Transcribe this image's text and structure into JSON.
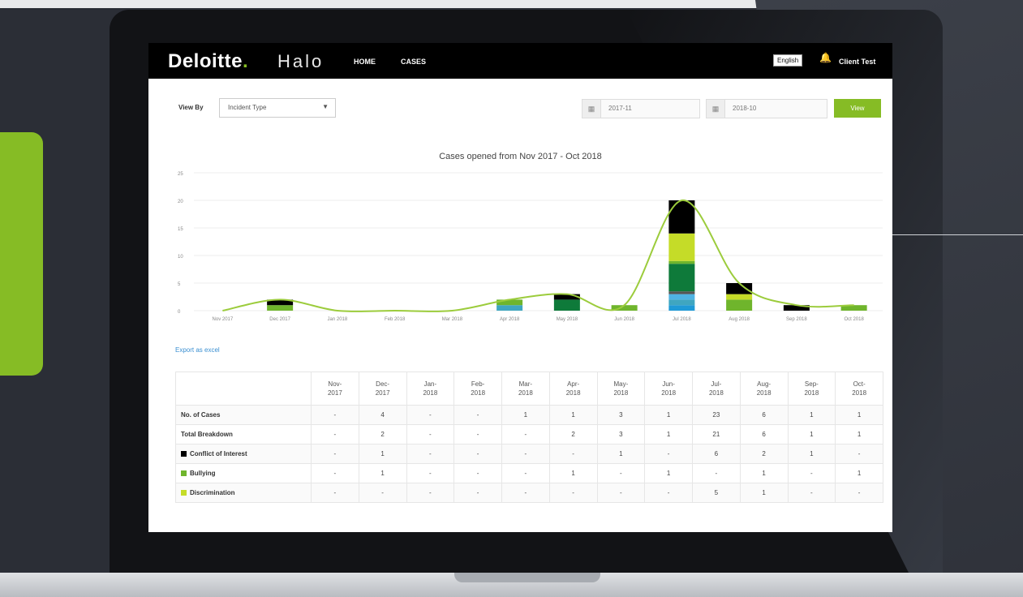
{
  "colors": {
    "accent": "#86bc25",
    "header_bg": "#000000",
    "link": "#3a8fd1"
  },
  "header": {
    "logo_text": "Deloitte",
    "logo_dot": ".",
    "product": "Halo",
    "nav": [
      "HOME",
      "CASES"
    ],
    "language": "English",
    "notification_icon": "bell-icon",
    "user": "Client Test"
  },
  "filters": {
    "view_by_label": "View By",
    "view_by_value": "Incident Type",
    "date_from": "2017-11",
    "date_to": "2018-10",
    "calendar_icon": "calendar-icon",
    "view_button": "View"
  },
  "chart_data": {
    "type": "bar",
    "title": "Cases opened from Nov 2017 - Oct 2018",
    "categories": [
      "Nov 2017",
      "Dec 2017",
      "Jan 2018",
      "Feb 2018",
      "Mar 2018",
      "Apr 2018",
      "May 2018",
      "Jun 2018",
      "Jul 2018",
      "Aug 2018",
      "Sep 2018",
      "Oct 2018"
    ],
    "y_ticks": [
      0,
      5,
      10,
      15,
      20,
      25
    ],
    "ylim": [
      0,
      25
    ],
    "series": [
      {
        "values": [
          0,
          0,
          0,
          0,
          0,
          0,
          0,
          0,
          1,
          0,
          0,
          0
        ],
        "color": "#1f9ad6"
      },
      {
        "values": [
          0,
          0,
          0,
          0,
          0,
          1,
          0,
          0,
          1,
          0,
          0,
          0
        ],
        "color": "#3fa6c0"
      },
      {
        "values": [
          0,
          0,
          0,
          0,
          0,
          0,
          0,
          0,
          1,
          0,
          0,
          0
        ],
        "color": "#4fb3e3"
      },
      {
        "values": [
          0,
          0,
          0,
          0,
          0,
          0,
          0,
          0,
          0.5,
          0,
          0,
          0
        ],
        "color": "#555555"
      },
      {
        "values": [
          0,
          0,
          0,
          0,
          0,
          0,
          2,
          0,
          5,
          0,
          0,
          0
        ],
        "color": "#0e7a3a"
      },
      {
        "values": [
          0,
          1,
          0,
          0,
          0,
          1,
          0,
          1,
          0.5,
          2,
          0,
          1
        ],
        "color": "#6fb52c"
      },
      {
        "values": [
          0,
          0,
          0,
          0,
          0,
          0,
          0,
          0,
          5,
          1,
          0,
          0
        ],
        "color": "#c5dc28"
      },
      {
        "values": [
          0,
          1,
          0,
          0,
          0,
          0,
          1,
          0,
          6,
          2,
          1,
          0
        ],
        "color": "#000000"
      }
    ],
    "trend_color": "#9ccc3c",
    "grid": true
  },
  "export_label": "Export as excel",
  "table": {
    "columns": [
      "Nov-\n2017",
      "Dec-\n2017",
      "Jan-\n2018",
      "Feb-\n2018",
      "Mar-\n2018",
      "Apr-\n2018",
      "May-\n2018",
      "Jun-\n2018",
      "Jul-\n2018",
      "Aug-\n2018",
      "Sep-\n2018",
      "Oct-\n2018"
    ],
    "rows": [
      {
        "label": "No. of Cases",
        "swatch": "",
        "cells": [
          "-",
          "4",
          "-",
          "-",
          "1",
          "1",
          "3",
          "1",
          "23",
          "6",
          "1",
          "1"
        ]
      },
      {
        "label": "Total Breakdown",
        "swatch": "",
        "cells": [
          "-",
          "2",
          "-",
          "-",
          "-",
          "2",
          "3",
          "1",
          "21",
          "6",
          "1",
          "1"
        ]
      },
      {
        "label": "Conflict of Interest",
        "swatch": "#000000",
        "cells": [
          "-",
          "1",
          "-",
          "-",
          "-",
          "-",
          "1",
          "-",
          "6",
          "2",
          "1",
          "-"
        ]
      },
      {
        "label": "Bullying",
        "swatch": "#6fb52c",
        "cells": [
          "-",
          "1",
          "-",
          "-",
          "-",
          "1",
          "-",
          "1",
          "-",
          "1",
          "-",
          "1"
        ]
      },
      {
        "label": "Discrimination",
        "swatch": "#c5dc28",
        "cells": [
          "-",
          "-",
          "-",
          "-",
          "-",
          "-",
          "-",
          "-",
          "5",
          "1",
          "-",
          "-"
        ]
      }
    ]
  }
}
